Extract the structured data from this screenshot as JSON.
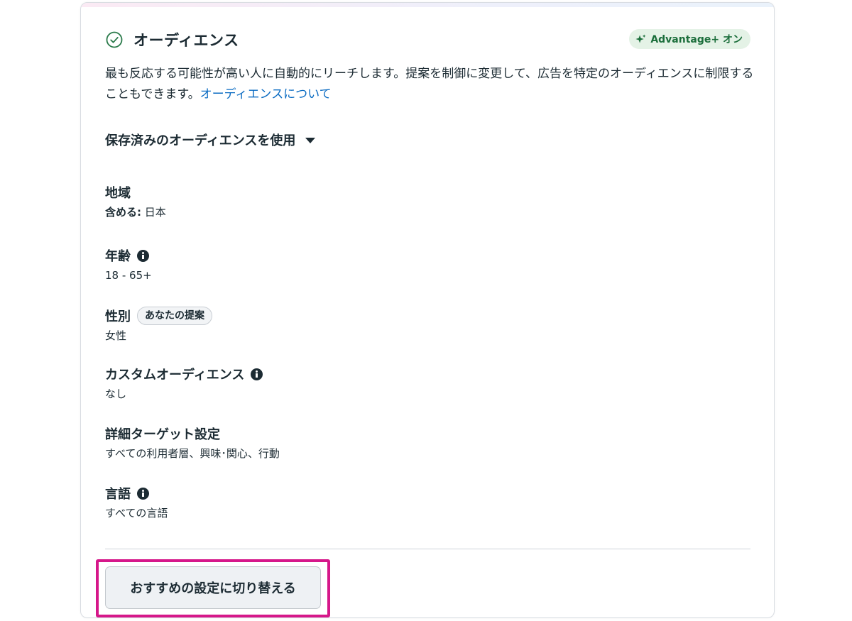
{
  "header": {
    "title": "オーディエンス",
    "badge_label": "Advantage+ オン"
  },
  "description": {
    "text": "最も反応する可能性が高い人に自動的にリーチします。提案を制御に変更して、広告を特定のオーディエンスに制限することもできます。",
    "link_label": "オーディエンスについて"
  },
  "saved_audience_dropdown": {
    "label": "保存済みのオーディエンスを使用"
  },
  "settings": {
    "location": {
      "title": "地域",
      "value_prefix": "含める:",
      "value": "日本"
    },
    "age": {
      "title": "年齢",
      "value": "18 - 65+"
    },
    "gender": {
      "title": "性別",
      "pill": "あなたの提案",
      "value": "女性"
    },
    "custom_audience": {
      "title": "カスタムオーディエンス",
      "value": "なし"
    },
    "detailed_targeting": {
      "title": "詳細ターゲット設定",
      "value": "すべての利用者層、興味･関心、行動"
    },
    "language": {
      "title": "言語",
      "value": "すべての言語"
    }
  },
  "footer": {
    "switch_button_label": "おすすめの設定に切り替える"
  },
  "colors": {
    "text": "#1c2b33",
    "link": "#0a6bc2",
    "advantage_badge_bg": "#e4f2e6",
    "advantage_badge_text": "#1b6e3b",
    "highlight": "#d6178a",
    "button_bg": "#eef1f4"
  },
  "icons": {
    "header": "check-circle-icon",
    "badge": "sparkle-icon",
    "dropdown": "caret-down-icon",
    "info": "info-icon"
  }
}
